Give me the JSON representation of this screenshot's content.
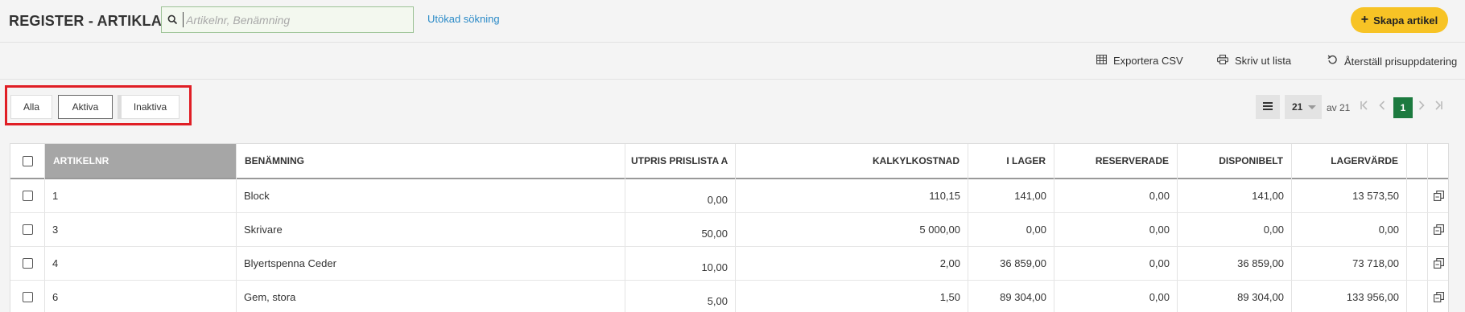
{
  "header": {
    "title": "REGISTER - ARTIKLAR",
    "search_placeholder": "Artikelnr, Benämning",
    "advanced_search": "Utökad sökning",
    "create_button": "Skapa artikel",
    "create_icon": "plus-icon"
  },
  "actions": {
    "export_csv": "Exportera CSV",
    "print_list": "Skriv ut lista",
    "reset_price_update": "Återställ prisuppdatering"
  },
  "filters": {
    "all": "Alla",
    "active": "Aktiva",
    "inactive": "Inaktiva",
    "selected": "Aktiva"
  },
  "pagination": {
    "page_size": "21",
    "of_text": "av 21",
    "current_page": "1"
  },
  "table": {
    "columns": [
      "ARTIKELNR",
      "BENÄMNING",
      "UTPRIS PRISLISTA A",
      "KALKYLKOSTNAD",
      "I LAGER",
      "RESERVERADE",
      "DISPONIBELT",
      "LAGERVÄRDE"
    ],
    "rows": [
      {
        "nr": "1",
        "name": "Block",
        "price": "0,00",
        "cost": "110,15",
        "stock": "141,00",
        "reserved": "0,00",
        "available": "141,00",
        "value": "13 573,50"
      },
      {
        "nr": "3",
        "name": "Skrivare",
        "price": "50,00",
        "cost": "5 000,00",
        "stock": "0,00",
        "reserved": "0,00",
        "available": "0,00",
        "value": "0,00"
      },
      {
        "nr": "4",
        "name": "Blyertspenna Ceder",
        "price": "10,00",
        "cost": "2,00",
        "stock": "36 859,00",
        "reserved": "0,00",
        "available": "36 859,00",
        "value": "73 718,00"
      },
      {
        "nr": "6",
        "name": "Gem, stora",
        "price": "5,00",
        "cost": "1,50",
        "stock": "89 304,00",
        "reserved": "0,00",
        "available": "89 304,00",
        "value": "133 956,00"
      }
    ]
  },
  "colors": {
    "accent_yellow": "#f7c325",
    "highlight_red": "#e01e25",
    "page_active_green": "#1c7a3f",
    "link_blue": "#2a8ac7"
  }
}
